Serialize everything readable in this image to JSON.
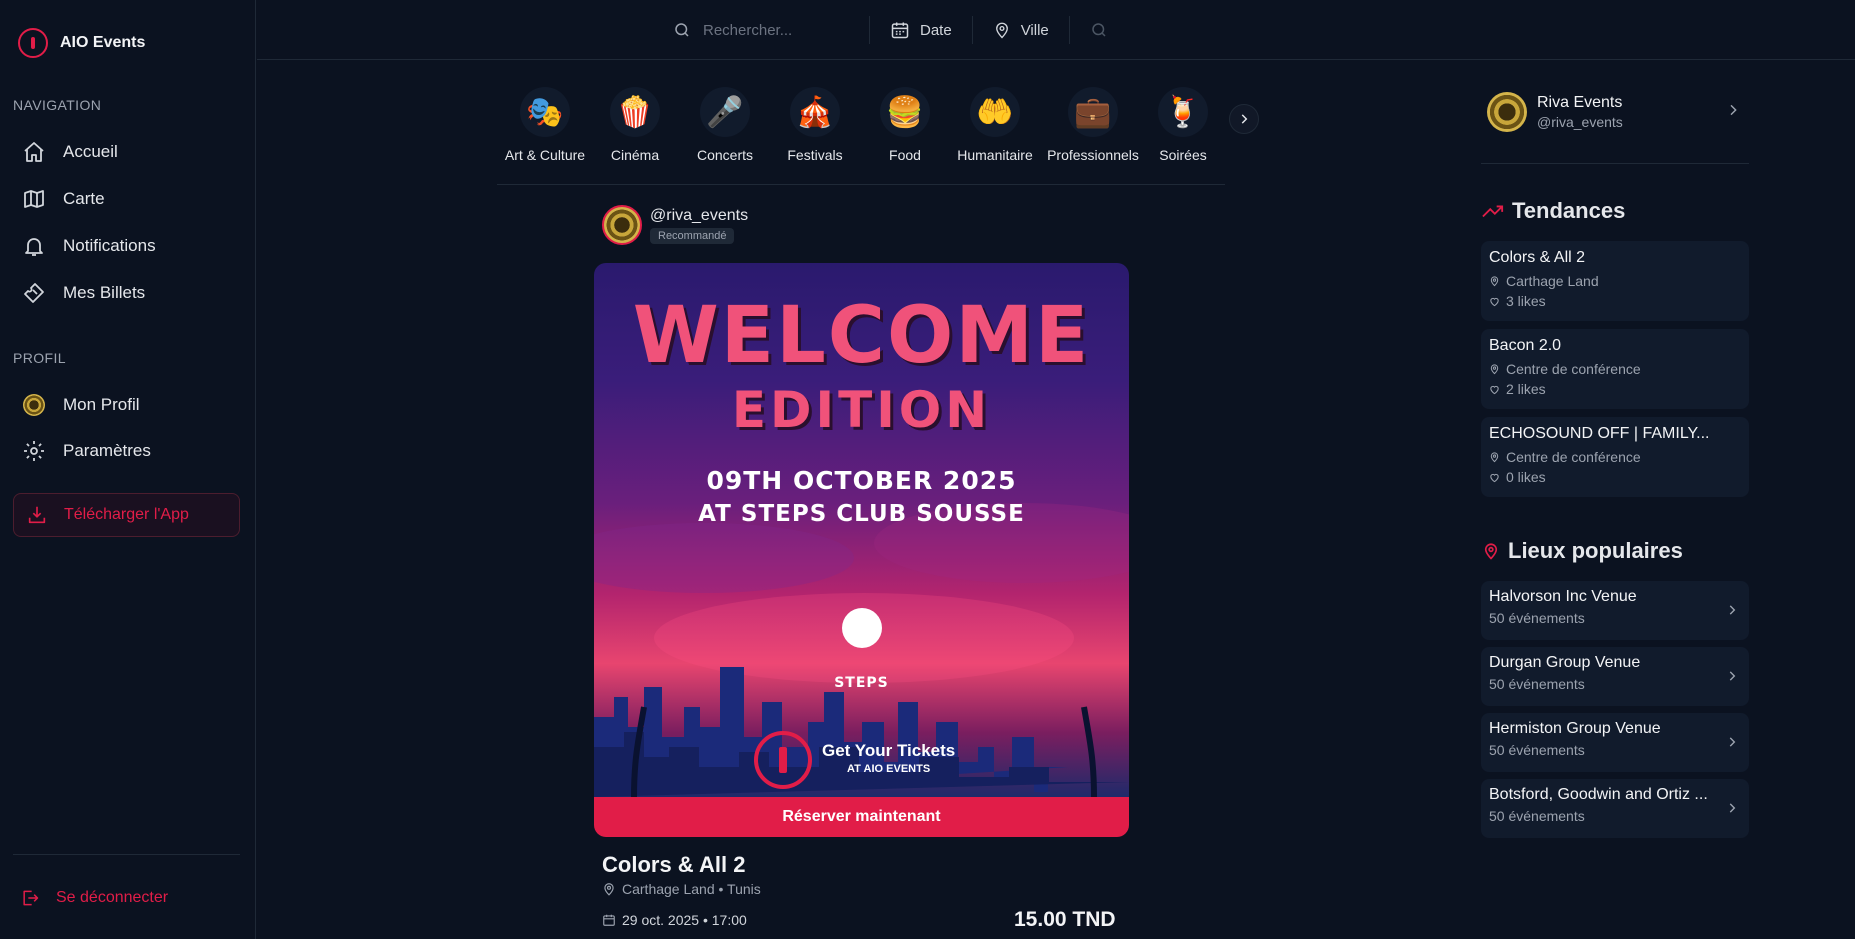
{
  "app": {
    "name": "AIO Events"
  },
  "sidebar": {
    "navigation_title": "NAVIGATION",
    "nav_items": [
      {
        "label": "Accueil",
        "icon": "home-icon"
      },
      {
        "label": "Carte",
        "icon": "map-icon"
      },
      {
        "label": "Notifications",
        "icon": "bell-icon"
      },
      {
        "label": "Mes Billets",
        "icon": "ticket-icon"
      }
    ],
    "profile_title": "PROFIL",
    "profile_items": [
      {
        "label": "Mon Profil",
        "icon": "avatar"
      },
      {
        "label": "Paramètres",
        "icon": "gear-icon"
      }
    ],
    "download_label": "Télécharger l'App",
    "logout_label": "Se déconnecter"
  },
  "topbar": {
    "search_placeholder": "Rechercher...",
    "date_label": "Date",
    "city_label": "Ville"
  },
  "categories": [
    {
      "label": "Art & Culture",
      "icon": "🎭"
    },
    {
      "label": "Cinéma",
      "icon": "🍿"
    },
    {
      "label": "Concerts",
      "icon": "🎤"
    },
    {
      "label": "Festivals",
      "icon": "🎪"
    },
    {
      "label": "Food",
      "icon": "🍔"
    },
    {
      "label": "Humanitaire",
      "icon": "🤲"
    },
    {
      "label": "Professionnels",
      "icon": "💼"
    },
    {
      "label": "Soirées",
      "icon": "🍹"
    }
  ],
  "post": {
    "handle": "@riva_events",
    "badge": "Recommandé",
    "poster": {
      "title_line1": "WELCOME",
      "title_line2": "EDITION",
      "date_line1": "09TH OCTOBER 2025",
      "date_line2": "AT STEPS CLUB SOUSSE",
      "brand": "STEPS",
      "cta_main": "Get Your Tickets",
      "cta_sub": "AT AIO EVENTS"
    },
    "book_label": "Réserver maintenant",
    "title": "Colors & All 2",
    "location": "Carthage Land • Tunis",
    "datetime": "29 oct. 2025 • 17:00",
    "price": "15.00 TND"
  },
  "right_panel": {
    "profile": {
      "name": "Riva Events",
      "handle": "@riva_events"
    },
    "trends_title": "Tendances",
    "trends": [
      {
        "title": "Colors & All 2",
        "location": "Carthage Land",
        "likes": "3 likes"
      },
      {
        "title": "Bacon 2.0",
        "location": "Centre de conférence",
        "likes": "2 likes"
      },
      {
        "title": "ECHOSOUND OFF | FAMILY...",
        "location": "Centre de conférence",
        "likes": "0 likes"
      }
    ],
    "venues_title": "Lieux populaires",
    "venues": [
      {
        "name": "Halvorson Inc Venue",
        "count": "50 événements"
      },
      {
        "name": "Durgan Group Venue",
        "count": "50 événements"
      },
      {
        "name": "Hermiston Group Venue",
        "count": "50 événements"
      },
      {
        "name": "Botsford, Goodwin and Ortiz ...",
        "count": "50 événements"
      }
    ]
  },
  "colors": {
    "accent": "#e11d48",
    "background": "#0b1220",
    "card": "#111b2c"
  }
}
